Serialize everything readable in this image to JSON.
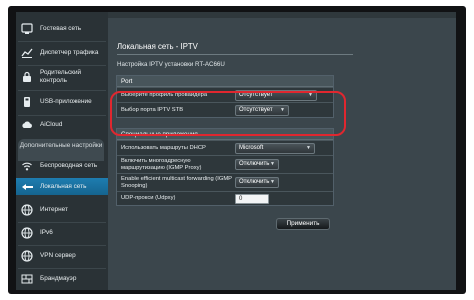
{
  "sidebar": {
    "items_top": [
      {
        "icon": "guest-network-icon",
        "label": "Гостевая сеть"
      },
      {
        "icon": "traffic-manager-icon",
        "label": "Диспетчер трафика"
      },
      {
        "icon": "parental-control-icon",
        "label": "Родительский контроль"
      },
      {
        "icon": "usb-icon",
        "label": "USB-приложение"
      },
      {
        "icon": "aicloud-icon",
        "label": "AiCloud"
      }
    ],
    "section_heading": "Дополнительные настройки",
    "items_bottom": [
      {
        "icon": "wireless-icon",
        "label": "Беспроводная сеть"
      },
      {
        "icon": "lan-icon",
        "label": "Локальная сеть",
        "active": true
      },
      {
        "icon": "internet-globe-icon",
        "label": "Интернет"
      },
      {
        "icon": "ipv6-globe-icon",
        "label": "IPv6"
      },
      {
        "icon": "vpn-globe-icon",
        "label": "VPN сервер"
      },
      {
        "icon": "firewall-icon",
        "label": "Брандмауэр"
      }
    ]
  },
  "main": {
    "title": "Локальная сеть - IPTV",
    "description": "Настройка IPTV установки RT-AC66U",
    "port_section": {
      "heading": "Port",
      "rows": [
        {
          "label": "Выберите профиль провайдера",
          "value": "Отсутствует"
        },
        {
          "label": "Выбор порта IPTV STB",
          "value": "Отсутствует"
        }
      ]
    },
    "special_section": {
      "heading": "Специальные приложения",
      "rows": [
        {
          "label": "Использовать маршруты DHCP",
          "value": "Microsoft",
          "kind": "select"
        },
        {
          "label": "Включить многоадресную маршрутизацию (IGMP Proxy)",
          "value": "Отключить",
          "kind": "select"
        },
        {
          "label": "Enable efficient multicast forwarding (IGMP Snooping)",
          "value": "Отключить",
          "kind": "select"
        },
        {
          "label": "UDP-прокси (Udpxy)",
          "value": "0",
          "kind": "text"
        }
      ]
    },
    "apply_label": "Применить"
  },
  "colors": {
    "highlight": "#e0272f",
    "active_nav": "#1e7db0",
    "panel": "#3b464c"
  }
}
